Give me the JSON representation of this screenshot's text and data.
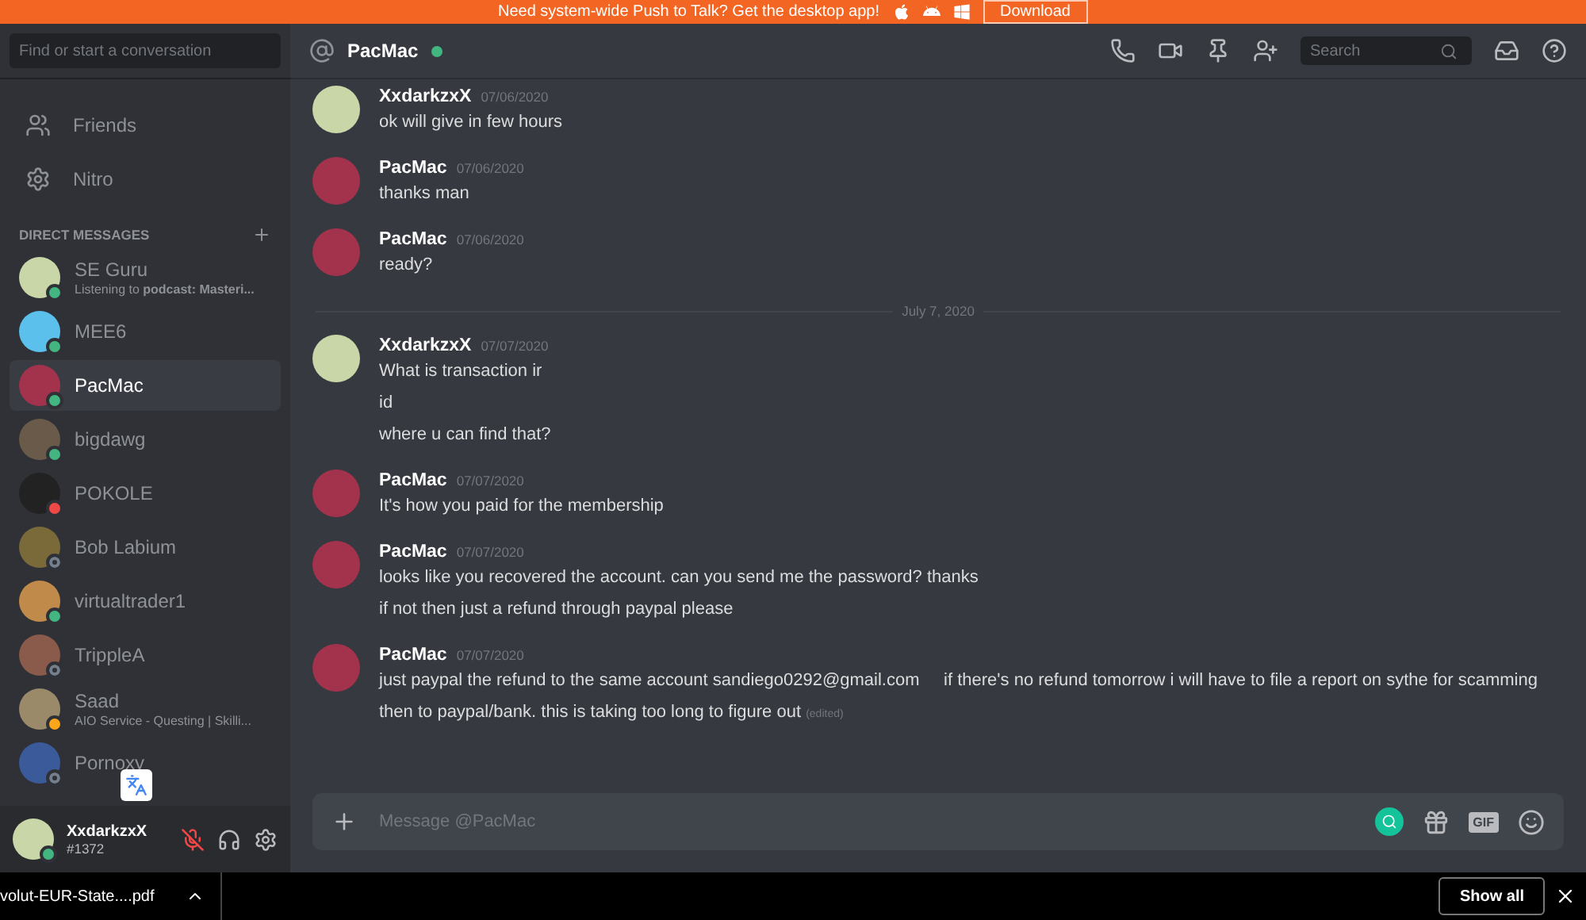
{
  "banner": {
    "text": "Need system-wide Push to Talk? Get the desktop app!",
    "button": "Download"
  },
  "sidebar": {
    "search": {
      "placeholder": "Find or start a conversation"
    },
    "nav": [
      {
        "kind": "friends",
        "label": "Friends"
      },
      {
        "kind": "nitro",
        "label": "Nitro"
      }
    ],
    "dm_header": "DIRECT MESSAGES",
    "dms": [
      {
        "name": "SE Guru",
        "color": "#43b581",
        "offline": false,
        "selected": false,
        "activity": "Listening to **podcast: Masteri...**"
      },
      {
        "name": "MEE6",
        "color": "#43b581",
        "offline": false,
        "selected": false
      },
      {
        "name": "PacMac",
        "color": "#43b581",
        "offline": false,
        "selected": true
      },
      {
        "name": "bigdawg",
        "color": "#43b581",
        "offline": false,
        "selected": false
      },
      {
        "name": "POKOLE",
        "color": "#f04747",
        "offline": false,
        "selected": false
      },
      {
        "name": "Bob Labium",
        "color": "#747f8d",
        "offline": true,
        "selected": false
      },
      {
        "name": "virtualtrader1",
        "color": "#43b581",
        "offline": false,
        "selected": false
      },
      {
        "name": "TrippleA",
        "color": "#747f8d",
        "offline": true,
        "selected": false
      },
      {
        "name": "Saad",
        "color": "#faa61a",
        "offline": false,
        "selected": false,
        "activity": "AIO Service - Questing | Skilli..."
      },
      {
        "name": "Pornoxy",
        "color": "#747f8d",
        "offline": true,
        "selected": false
      }
    ],
    "user": {
      "name": "XxdarkzxX",
      "tag": "#1372",
      "color": "#43b581",
      "muted": true
    }
  },
  "channel": {
    "name": "PacMac",
    "color": "#43b581",
    "search_placeholder": "Search"
  },
  "messages": [
    {
      "kind": "message",
      "author": "XxdarkzxX",
      "date": "07/06/2020",
      "lines": [
        "ok will give in few hours"
      ]
    },
    {
      "kind": "message",
      "author": "PacMac",
      "date": "07/06/2020",
      "lines": [
        "thanks man"
      ]
    },
    {
      "kind": "message",
      "author": "PacMac",
      "date": "07/06/2020",
      "lines": [
        "ready?"
      ]
    },
    {
      "kind": "divider",
      "text": "July 7, 2020"
    },
    {
      "kind": "message",
      "author": "XxdarkzxX",
      "date": "07/07/2020",
      "lines": [
        "What is transaction ir",
        "id",
        "where u can find that?"
      ]
    },
    {
      "kind": "message",
      "author": "PacMac",
      "date": "07/07/2020",
      "lines": [
        "It's how you paid for the membership"
      ]
    },
    {
      "kind": "message",
      "author": "PacMac",
      "date": "07/07/2020",
      "lines": [
        "looks like you recovered the account. can you send me the password? thanks",
        "if not then just a refund through paypal please"
      ]
    },
    {
      "kind": "message",
      "author": "PacMac",
      "date": "07/07/2020",
      "lines": [
        "just paypal the refund to the same account sandiego0292@gmail.com     if there's no refund tomorrow i will have to file a report on sythe for scamming then to paypal/bank. this is taking too long to figure out"
      ],
      "edited": "(edited)"
    }
  ],
  "composer": {
    "placeholder": "Message @PacMac",
    "gif": "GIF"
  },
  "downloads": {
    "file": "volut-EUR-State....pdf",
    "button": "Show all"
  }
}
